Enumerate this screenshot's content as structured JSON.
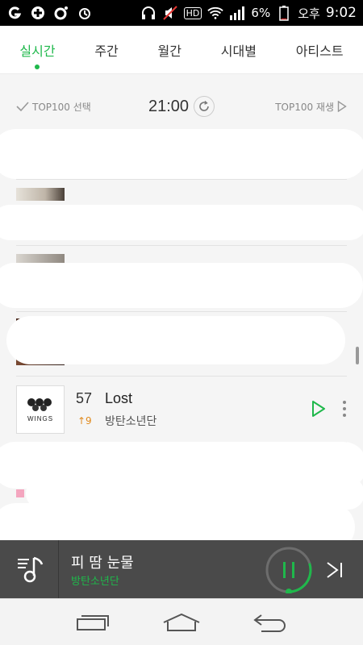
{
  "status_bar": {
    "battery_percent": "6%",
    "meridiem": "오후",
    "time": "9:02",
    "hd_badge": "HD",
    "icons": [
      "g-app-icon",
      "plus-app-icon",
      "camera-icon",
      "alarm-icon",
      "headphones-icon",
      "silent-icon",
      "hd-icon",
      "wifi-icon",
      "signal-icon",
      "battery-icon"
    ]
  },
  "tabs": [
    {
      "label": "실시간",
      "active": true
    },
    {
      "label": "주간",
      "active": false
    },
    {
      "label": "월간",
      "active": false
    },
    {
      "label": "시대별",
      "active": false
    },
    {
      "label": "아티스트",
      "active": false
    }
  ],
  "chart_controls": {
    "select_all_label": "TOP100 선택",
    "update_time": "21:00",
    "play_all_label": "TOP100 재생"
  },
  "songs": [
    {
      "rank": "57",
      "change": "↑9",
      "title": "Lost",
      "artist": "방탄소년단",
      "cover_text": "WINGS"
    }
  ],
  "player": {
    "title": "피 땀 눈물",
    "artist": "방탄소년단",
    "progress": 0.3
  },
  "colors": {
    "accent": "#1fb84b",
    "rank_up": "#e08a1e",
    "player_bg": "#4a4a4a"
  }
}
